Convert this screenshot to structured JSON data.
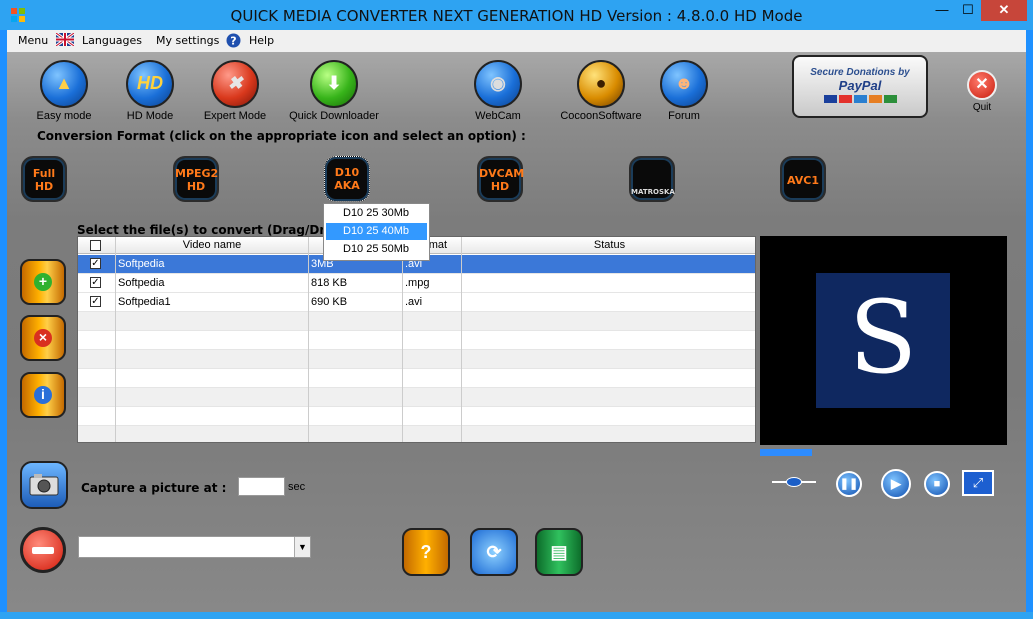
{
  "window": {
    "title": "QUICK MEDIA CONVERTER NEXT GENERATION HD Version : 4.8.0.0 HD Mode",
    "min": "—",
    "max": "☐",
    "close": "✕"
  },
  "menu": {
    "menu": "Menu",
    "languages": "Languages",
    "settings": "My settings",
    "help": "Help"
  },
  "toolbar": {
    "easy": "Easy mode",
    "hd": "HD Mode",
    "hd_glyph": "HD",
    "expert": "Expert Mode",
    "downloader": "Quick Downloader",
    "webcam": "WebCam",
    "cocoon": "CocoonSoftware",
    "forum": "Forum",
    "quit": "Quit"
  },
  "donate": {
    "line1": "Secure Donations by",
    "line2": "PayPal"
  },
  "conversion": {
    "title": "Conversion Format (click on the appropriate icon and select an option) :",
    "formats": [
      {
        "label": "Full HD"
      },
      {
        "label": "MPEG2 HD"
      },
      {
        "label": "D10 AKA"
      },
      {
        "label": "DVCAM HD"
      },
      {
        "label": "MATROSKA"
      },
      {
        "label": "AVC1"
      }
    ],
    "dropdown": [
      "D10 25 30Mb",
      "D10 25 40Mb",
      "D10 25 50Mb"
    ],
    "dropdown_selected": 1
  },
  "files": {
    "label": "Select the  file(s) to convert (Drag/Drop)",
    "columns": [
      "Video name",
      "",
      "ormat",
      "Status"
    ],
    "rows": [
      {
        "name": "Softpedia",
        "size": "3MB",
        "format": ".avi",
        "status": "",
        "checked": true
      },
      {
        "name": "Softpedia",
        "size": "818 KB",
        "format": ".mpg",
        "status": "",
        "checked": true
      },
      {
        "name": "Softpedia1",
        "size": "690 KB",
        "format": ".avi",
        "status": "",
        "checked": true
      }
    ]
  },
  "preview": {
    "letter": "S"
  },
  "capture": {
    "label": "Capture a picture at  :",
    "unit": "sec",
    "value": ""
  },
  "colors": {
    "accent": "#2ea3f2",
    "format_text": "#ff7a1a",
    "selection": "#3b78d8"
  }
}
